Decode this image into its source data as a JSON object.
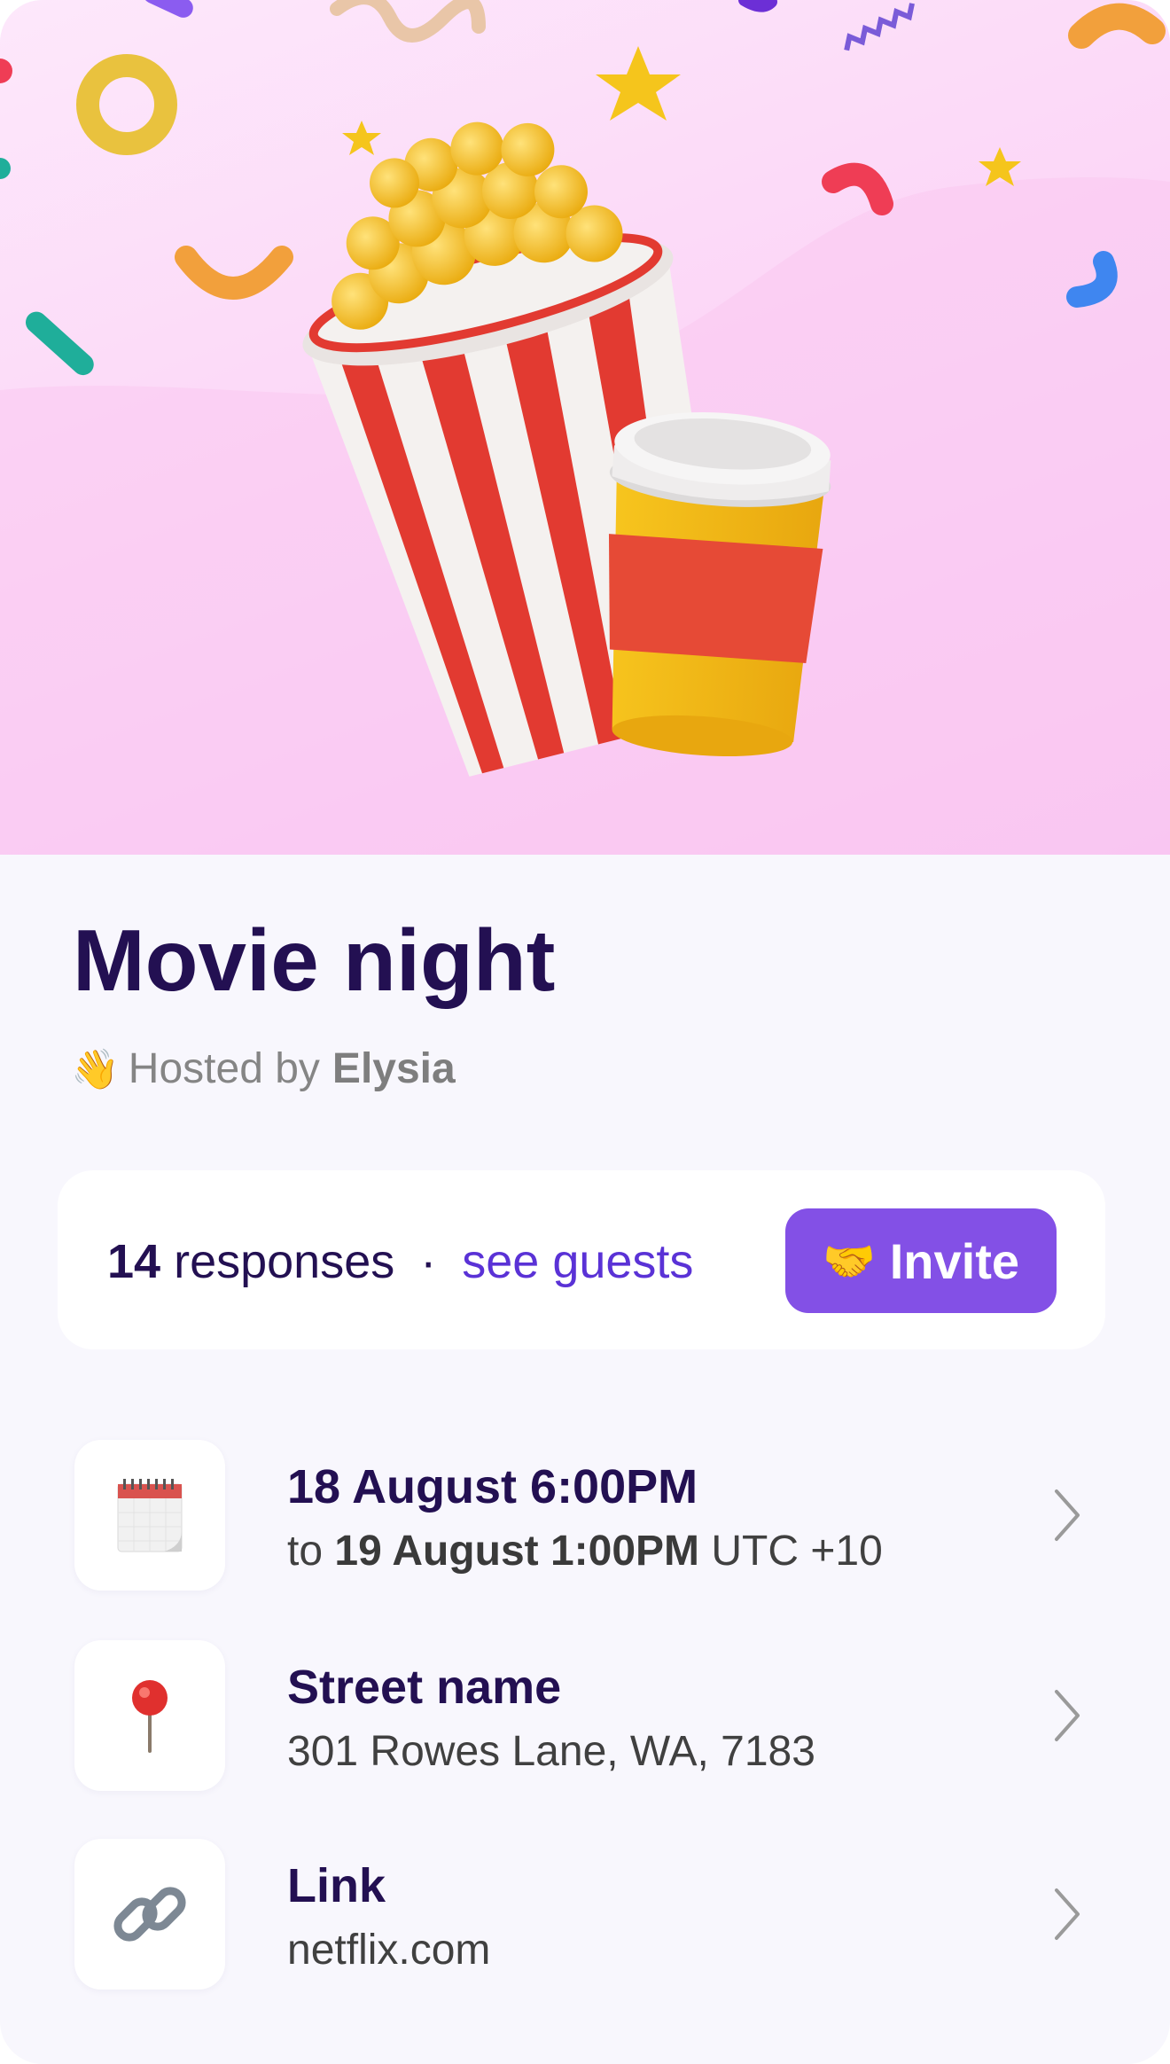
{
  "event": {
    "title": "Movie night",
    "host_prefix": "Hosted by",
    "host_name": "Elysia",
    "host_emoji": "👋"
  },
  "responses": {
    "count": "14",
    "label": "responses",
    "separator": "·",
    "see_guests": "see guests",
    "invite_emoji": "🤝",
    "invite_label": "Invite"
  },
  "details": [
    {
      "icon": "calendar-icon",
      "line1": "18 August 6:00PM",
      "line2_prefix": "to",
      "line2_bold": "19 August 1:00PM",
      "line2_suffix": "UTC +10"
    },
    {
      "icon": "pushpin-icon",
      "emoji": "📍",
      "line1": "Street name",
      "line2": "301 Rowes Lane, WA, 7183"
    },
    {
      "icon": "link-icon",
      "emoji": "🔗",
      "line1": "Link",
      "line2": "netflix.com"
    }
  ],
  "colors": {
    "title": "#231052",
    "accent": "#8350e6",
    "link": "#5a32d6",
    "hero_bg": "#fcd7f7"
  }
}
